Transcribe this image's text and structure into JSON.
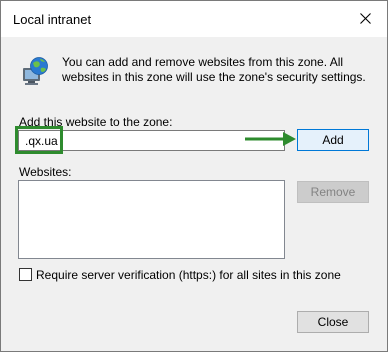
{
  "window": {
    "title": "Local intranet",
    "close_icon": "close-icon"
  },
  "info": {
    "icon": "globe-computer-icon",
    "text": "You can add and remove websites from this zone. All websites in this zone will use the zone's security settings."
  },
  "add_section": {
    "label": "Add this website to the zone:",
    "input_value": ".qx.ua",
    "add_button_label": "Add",
    "highlight_color": "#2e8b2e"
  },
  "websites_section": {
    "label": "Websites:",
    "items": [],
    "remove_button_label": "Remove"
  },
  "https_checkbox": {
    "label": "Require server verification (https:) for all sites in this zone",
    "checked": false
  },
  "footer": {
    "close_button_label": "Close"
  },
  "colors": {
    "accent": "#0078d7",
    "annotation": "#2e8b2e",
    "dialog_background": "#f0f0f0"
  }
}
